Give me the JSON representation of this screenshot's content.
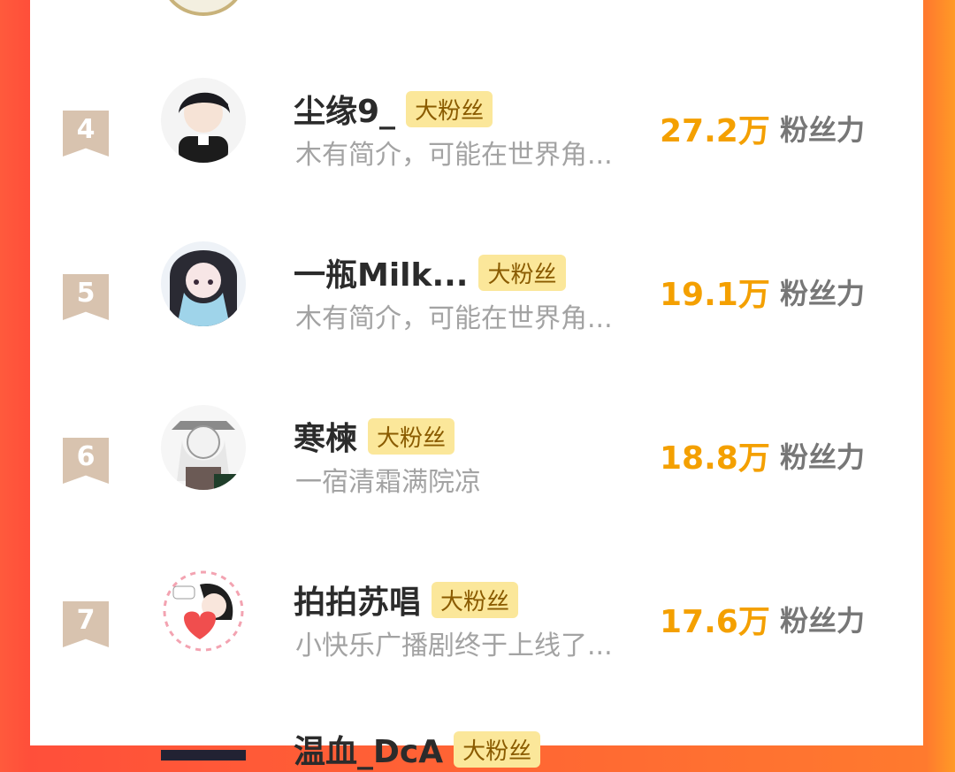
{
  "leaderboard": {
    "score_label": "粉丝力",
    "tag_label": "大粉丝",
    "items": [
      {
        "rank": "4",
        "name": "尘缘9_",
        "desc": "木有简介，可能在世界角...",
        "score": "27.2万"
      },
      {
        "rank": "5",
        "name": "一瓶Milk...",
        "desc": "木有简介，可能在世界角...",
        "score": "19.1万"
      },
      {
        "rank": "6",
        "name": "寒楝",
        "desc": "一宿清霜满院凉",
        "score": "18.8万"
      },
      {
        "rank": "7",
        "name": "拍拍苏唱",
        "desc": "小快乐广播剧终于上线了...",
        "score": "17.6万"
      }
    ],
    "partial_next": {
      "name": "温血_DcA"
    }
  }
}
